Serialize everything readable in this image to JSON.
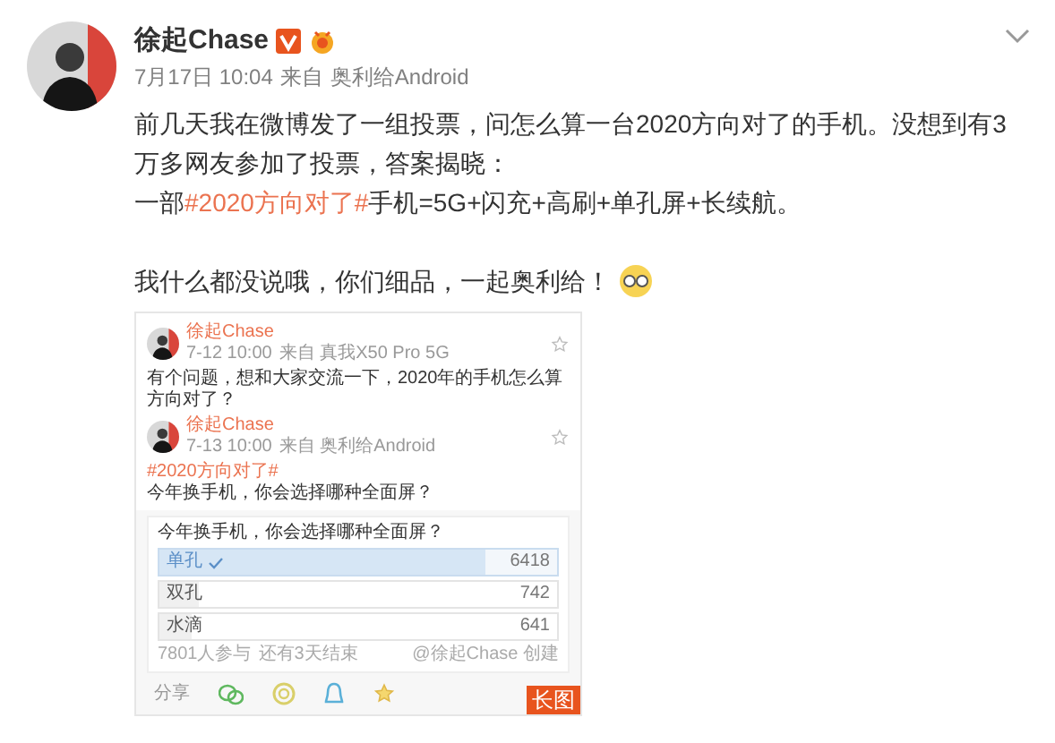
{
  "post": {
    "author": "徐起Chase",
    "time": "7月17日 10:04",
    "source_prefix": "来自",
    "source": "奥利给Android",
    "paragraphs": [
      [
        {
          "text": "前几天我在微博发了一组投票，问怎么算一台2020方向对了的手机。没想到有3万多网友参加了投票，答案揭晓："
        }
      ],
      [
        {
          "text": "一部"
        },
        {
          "text": "#2020方向对了#",
          "kind": "hashtag"
        },
        {
          "text": "手机=5G+闪充+高刷+单孔屏+长续航。"
        }
      ],
      [
        {
          "text": "我什么都没说哦，你们细品，一起奥利给！"
        }
      ]
    ]
  },
  "image": {
    "badge": "长图",
    "posts": [
      {
        "author": "徐起Chase",
        "time": "7-12 10:00",
        "source": "来自 真我X50 Pro 5G",
        "text": "有个问题，想和大家交流一下，2020年的手机怎么算方向对了？"
      },
      {
        "author": "徐起Chase",
        "time": "7-13 10:00",
        "source": "来自 奥利给Android",
        "hashtag": "#2020方向对了#",
        "text": "今年换手机，你会选择哪种全面屏？"
      }
    ],
    "poll": {
      "title": "今年换手机，你会选择哪种全面屏？",
      "options": [
        {
          "label": "单孔",
          "count": "6418",
          "selected": true,
          "level": 0.82
        },
        {
          "label": "双孔",
          "count": "742",
          "selected": false,
          "level": 0.1
        },
        {
          "label": "水滴",
          "count": "641",
          "selected": false,
          "level": 0.08
        }
      ],
      "participants": "7801人参与",
      "remaining": "还有3天结束",
      "creator": "@徐起Chase 创建"
    },
    "share_label": "分享"
  }
}
